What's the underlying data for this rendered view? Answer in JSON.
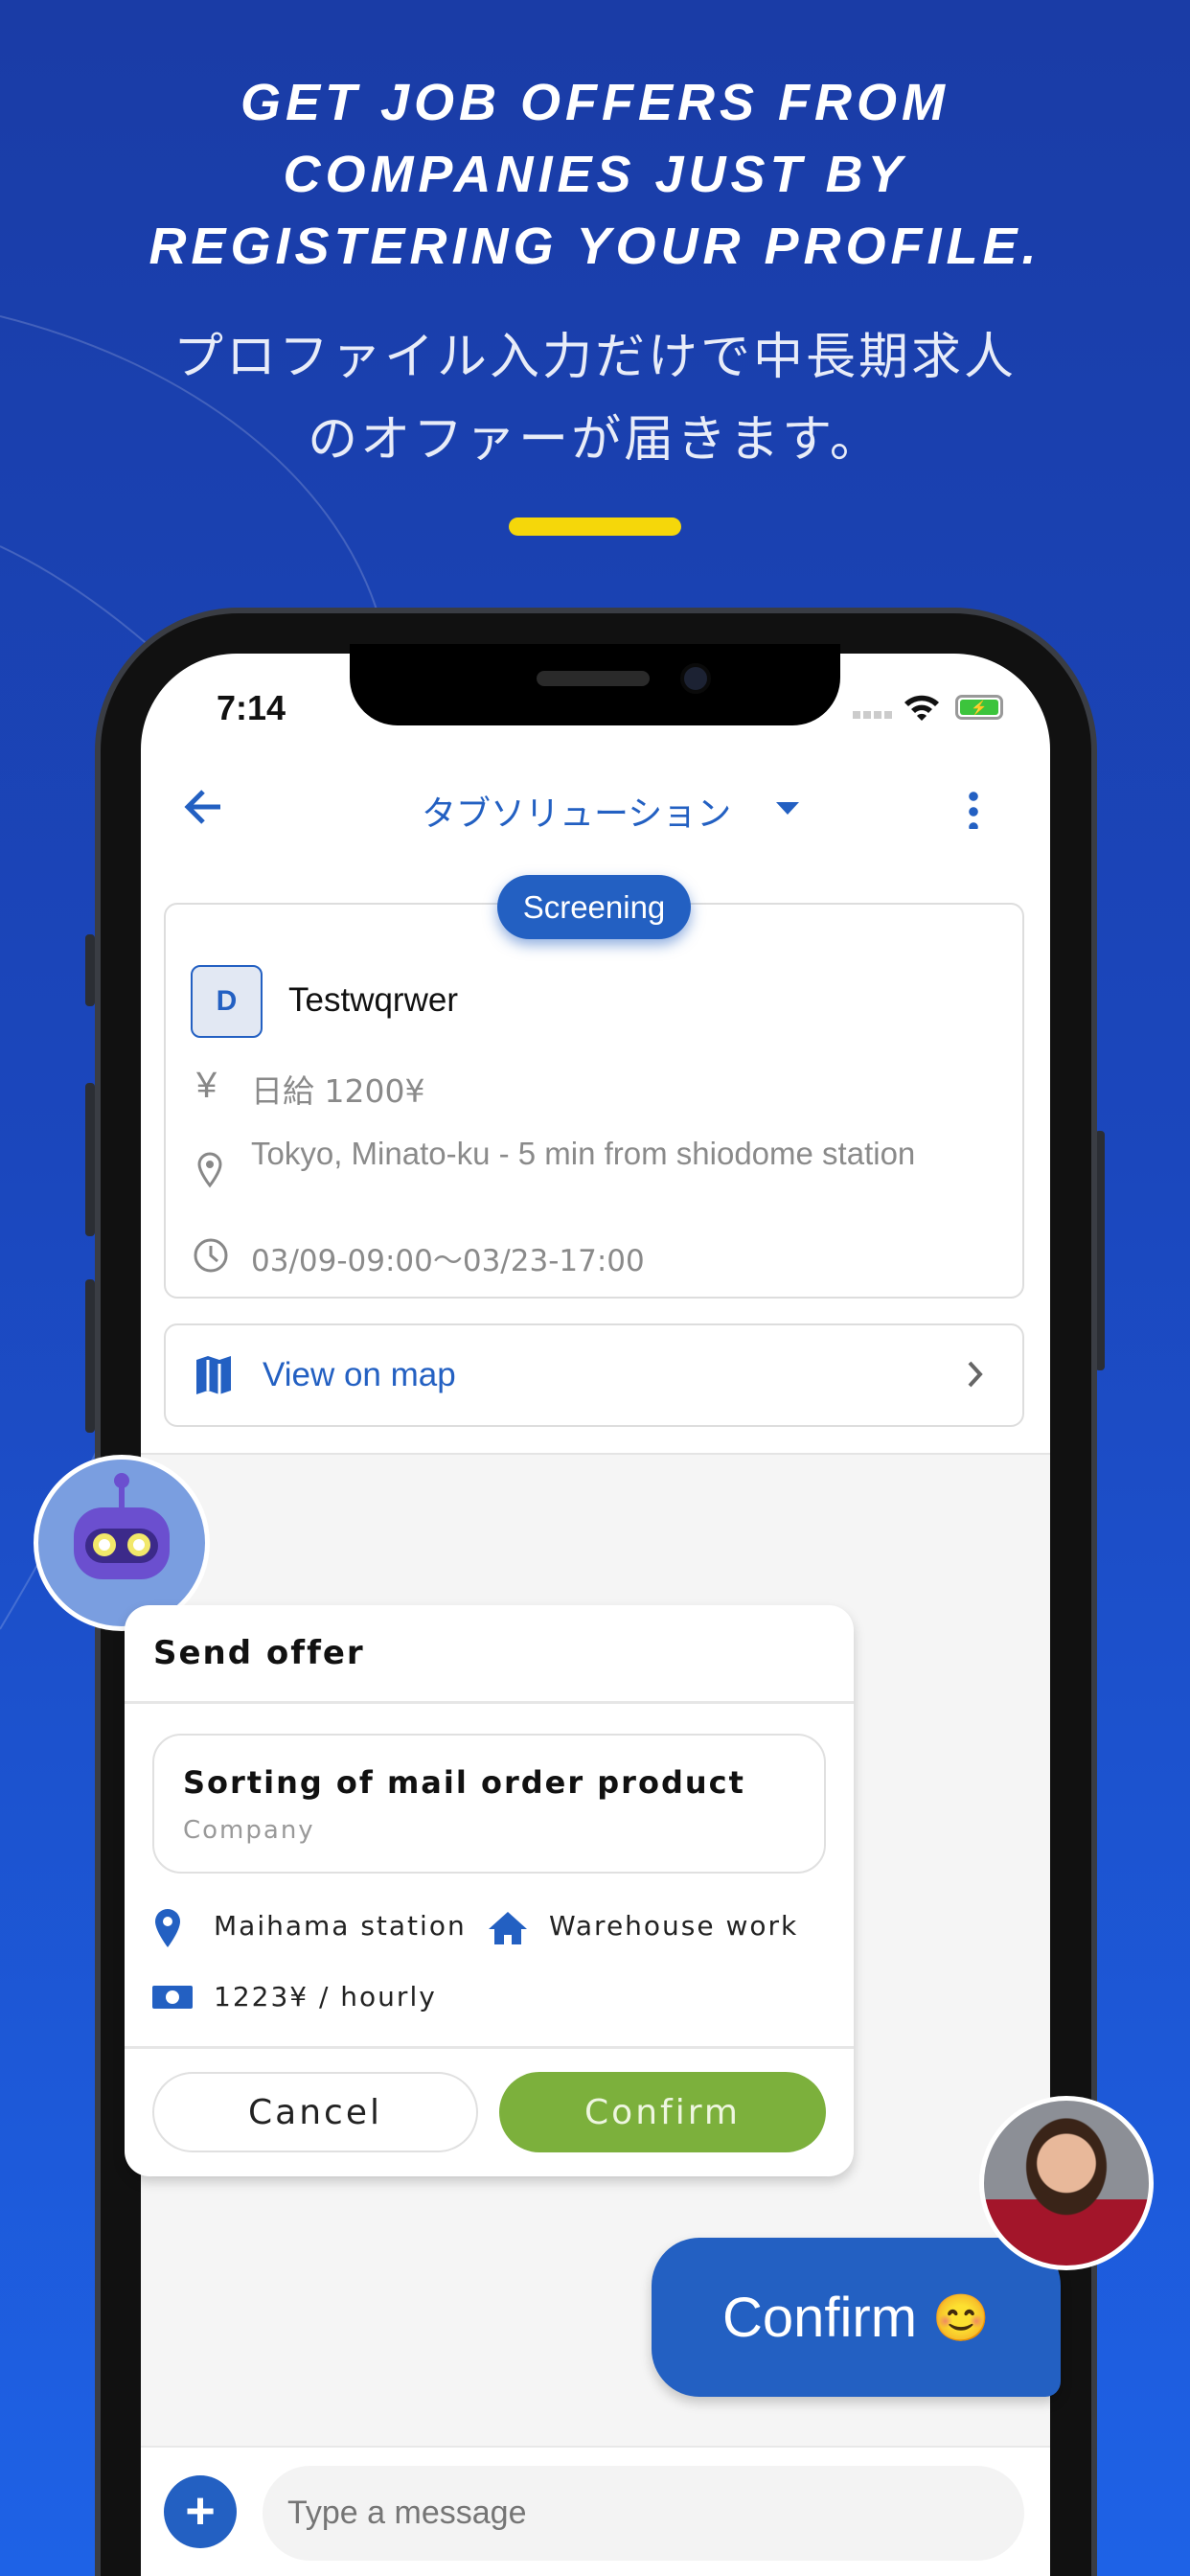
{
  "promo": {
    "headline": [
      "Get job offers from",
      "companies just by",
      "registering your profile."
    ],
    "subtitle": [
      "プロファイル入力だけで中長期求人",
      "のオファーが届きます。"
    ],
    "accent_color": "#f5d70a"
  },
  "status_bar": {
    "time": "7:14",
    "icons": [
      "signal-icon",
      "wifi-icon",
      "battery-charging-icon"
    ]
  },
  "nav": {
    "title": "タブソリューション",
    "back_icon": "arrow-left-icon",
    "dropdown_icon": "caret-down-icon",
    "menu_icon": "more-vertical-icon"
  },
  "job_card": {
    "status": "Screening",
    "avatar_letter": "D",
    "name": "Testwqrwer",
    "salary_icon": "¥",
    "salary": "日給 1200¥",
    "location": "Tokyo, Minato-ku - 5 min from shiodome station",
    "period": "03/09-09:00～03/23-17:00"
  },
  "map_link": {
    "label": "View on map"
  },
  "offer": {
    "title": "Send offer",
    "job_title": "Sorting of mail order product",
    "company": "Company",
    "station": "Maihama station",
    "category": "Warehouse work",
    "wage": "1223¥ / hourly",
    "cancel": "Cancel",
    "confirm": "Confirm",
    "confirm_color": "#7cb03c"
  },
  "reply": {
    "text": "Confirm",
    "emoji": "😊"
  },
  "composer": {
    "placeholder": "Type a message"
  },
  "colors": {
    "primary": "#2360c2"
  }
}
